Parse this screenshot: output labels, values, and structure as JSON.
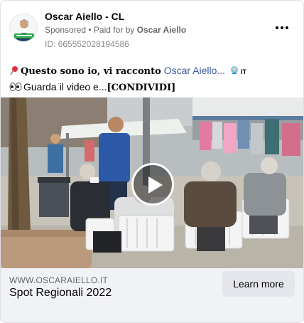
{
  "post": {
    "page_name": "Oscar Aiello - CL",
    "sponsored_label": "Sponsored",
    "separator": " • ",
    "paid_for_prefix": "Paid for by ",
    "paid_for_name": "Oscar Aiello",
    "ad_id": "ID: 665552028194586",
    "more_icon": "more-horizontal-icon"
  },
  "body": {
    "line1_bold": "Questo sono io, vi racconto",
    "line1_link": "Oscar Aiello...",
    "line1_flag": "IT",
    "line2_text": "Guarda il video e...",
    "line2_bold": "[CONDIVIDI]"
  },
  "media": {
    "type": "video",
    "play_icon": "play-icon"
  },
  "footer": {
    "domain": "WWW.OSCARAIELLO.IT",
    "headline": "Spot Regionali 2022",
    "cta_label": "Learn more"
  },
  "colors": {
    "link": "#385898",
    "secondary_text": "#65676b",
    "footer_bg": "#f0f2f5",
    "button_bg": "#e4e6eb"
  }
}
